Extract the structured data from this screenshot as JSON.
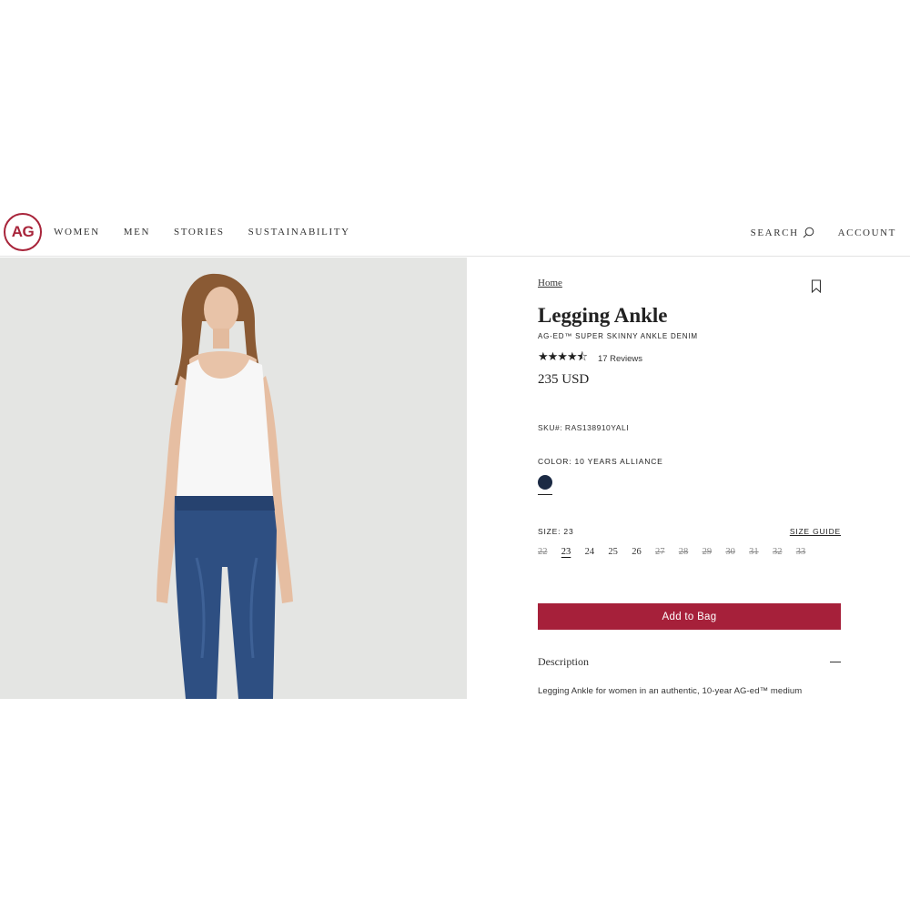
{
  "header": {
    "logo_text": "AG",
    "nav": [
      "WOMEN",
      "MEN",
      "STORIES",
      "SUSTAINABILITY"
    ],
    "search_label": "SEARCH",
    "account_label": "ACCOUNT"
  },
  "product": {
    "breadcrumb": "Home",
    "title": "Legging Ankle",
    "subtitle": "AG-ED™ SUPER SKINNY ANKLE DENIM",
    "rating": 4.5,
    "stars": "★★★★⯪",
    "reviews": "17 Reviews",
    "price": "235 USD",
    "sku": "SKU#: RAS138910YALI",
    "color_label": "COLOR: 10 YEARS ALLIANCE",
    "color_swatch": "#1b2a44",
    "size_label": "SIZE: 23",
    "size_guide": "SIZE GUIDE",
    "sizes": [
      {
        "label": "22",
        "available": false
      },
      {
        "label": "23",
        "available": true,
        "selected": true
      },
      {
        "label": "24",
        "available": true
      },
      {
        "label": "25",
        "available": true
      },
      {
        "label": "26",
        "available": true
      },
      {
        "label": "27",
        "available": false
      },
      {
        "label": "28",
        "available": false
      },
      {
        "label": "29",
        "available": false
      },
      {
        "label": "30",
        "available": false
      },
      {
        "label": "31",
        "available": false
      },
      {
        "label": "32",
        "available": false
      },
      {
        "label": "33",
        "available": false
      }
    ],
    "add_to_bag": "Add to Bag",
    "description_title": "Description",
    "description_text": "Legging Ankle for women in an authentic, 10-year AG-ed™ medium"
  },
  "colors": {
    "brand": "#a6203a",
    "image_background": "#e4e5e3"
  }
}
